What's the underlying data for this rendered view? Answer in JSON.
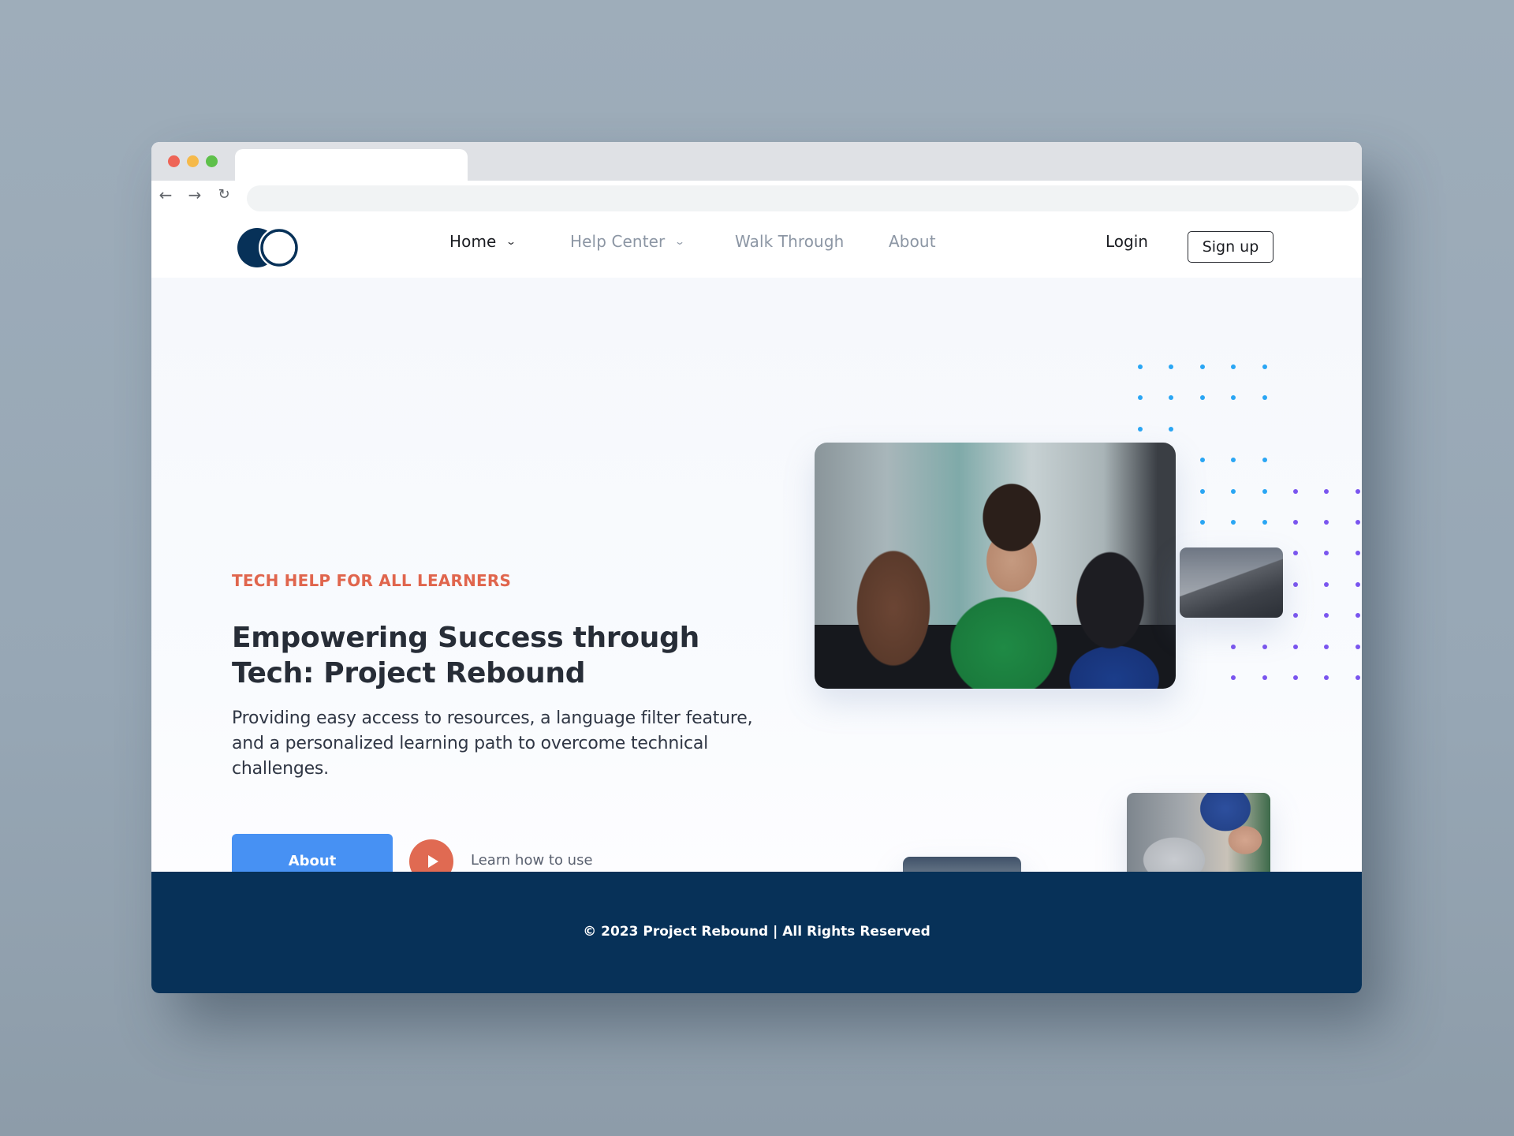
{
  "browser": {
    "address_value": "",
    "back_icon": "←",
    "forward_icon": "→",
    "reload_icon": "↻"
  },
  "nav": {
    "items": [
      {
        "label": "Home",
        "active": true,
        "has_dropdown": true
      },
      {
        "label": "Help Center",
        "active": false,
        "has_dropdown": true
      },
      {
        "label": "Walk Through",
        "active": false,
        "has_dropdown": false
      },
      {
        "label": "About",
        "active": false,
        "has_dropdown": false
      }
    ],
    "chevron_icon": "⌄",
    "login_label": "Login",
    "signup_label": "Sign up"
  },
  "hero": {
    "eyebrow": "TECH HELP FOR ALL LEARNERS",
    "headline": "Empowering Success through Tech: Project Rebound",
    "description": "Providing easy access to resources, a language filter feature, and a personalized learning path to overcome technical challenges.",
    "primary_button_label": "About",
    "video_link_label": "Learn how to use"
  },
  "images": [
    {
      "name": "students-at-computers-photo",
      "alt": "Instructor helping two students at computers"
    },
    {
      "name": "typing-on-laptop-photo",
      "alt": "Hands typing on a laptop"
    },
    {
      "name": "group-pointing-at-laptop-photo",
      "alt": "Group pointing at a laptop from above"
    },
    {
      "name": "team-laptop-discussion-photo",
      "alt": "Team discussing around a laptop"
    }
  ],
  "footer": {
    "copyright": "© 2023 Project Rebound | All Rights Reserved"
  },
  "colors": {
    "brand_navy": "#073158",
    "accent_orange": "#e0654d",
    "primary_blue": "#4791f3",
    "dot_blue": "#2aa6f4",
    "dot_purple": "#7a55ef",
    "heading_text": "#272d37",
    "nav_muted": "#8c96a4"
  }
}
